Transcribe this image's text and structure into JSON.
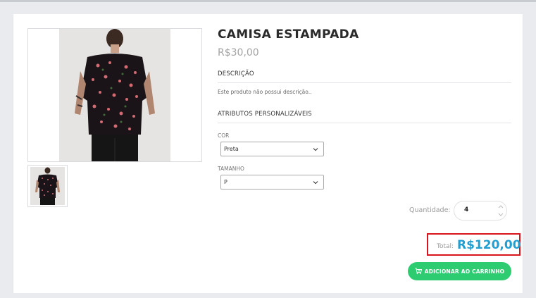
{
  "product": {
    "title": "CAMISA ESTAMPADA",
    "price": "R$30,00",
    "description_heading": "DESCRIÇÃO",
    "description_text": "Este produto não possui descrição..",
    "attributes_heading": "ATRIBUTOS PERSONALIZÁVEIS"
  },
  "attributes": {
    "color": {
      "label": "COR",
      "selected": "Preta"
    },
    "size": {
      "label": "TAMANHO",
      "selected": "P"
    }
  },
  "quantity": {
    "label": "Quantidade:",
    "value": "4"
  },
  "total": {
    "label": "Total:",
    "value": "R$120,00",
    "highlight_color": "#d9141b",
    "value_color": "#1f9fd3"
  },
  "cart_button": {
    "label": "ADICIONAR AO CARRINHO",
    "color": "#2ecc71",
    "icon": "cart-plus-icon"
  },
  "images": {
    "main": "product-photo",
    "thumbnail": "product-thumbnail"
  }
}
